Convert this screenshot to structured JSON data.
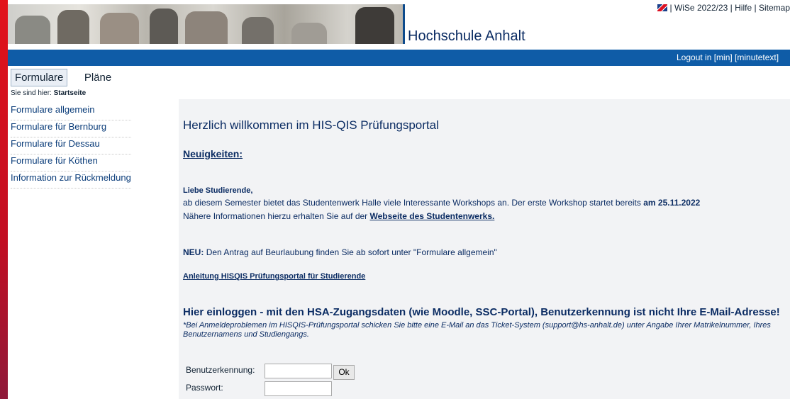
{
  "header": {
    "school_name": "Hochschule Anhalt",
    "semester": "WiSe 2022/23",
    "help": "Hilfe",
    "sitemap": "Sitemap",
    "separator": "|"
  },
  "bar": {
    "logout_text": "Logout in [min] [minutetext]"
  },
  "tabs": [
    {
      "label": "Formulare"
    },
    {
      "label": "Pläne"
    }
  ],
  "breadcrumb": {
    "prefix": "Sie sind hier:",
    "current": "Startseite"
  },
  "sidebar": {
    "items": [
      {
        "label": "Formulare allgemein"
      },
      {
        "label": "Formulare für Bernburg"
      },
      {
        "label": "Formulare für Dessau"
      },
      {
        "label": "Formulare für Köthen"
      },
      {
        "label": "Information zur Rückmeldung"
      }
    ]
  },
  "main": {
    "welcome": "Herzlich willkommen im HIS-QIS Prüfungsportal",
    "news_title": "Neuigkeiten:",
    "greeting": "Liebe Studierende,",
    "line1_text": "ab diesem Semester bietet das Studentenwerk Halle viele Interessante Workshops an. Der erste Workshop startet bereits",
    "line1_bold": "am 25.11.2022",
    "line2_text": "Nähere Informationen hierzu erhalten Sie auf der",
    "line2_link": "Webseite des Studentenwerks.",
    "neu_label": "NEU:",
    "neu_text": "Den Antrag auf Beurlaubung finden Sie ab sofort unter \"Formulare allgemein\"",
    "anleitung": "Anleitung HISQIS Prüfungsportal für Studierende",
    "login_heading": "Hier einloggen - mit den HSA-Zugangsdaten (wie Moodle, SSC-Portal), Benutzerkennung ist nicht Ihre E-Mail-Adresse!",
    "login_note": "*Bei Anmeldeproblemen im HISQIS-Prüfungsportal schicken Sie bitte eine E-Mail an das Ticket-System (support@hs-anhalt.de) unter Angabe Ihrer Matrikelnummer, Ihres Benutzernamens und Studiengangs."
  },
  "login": {
    "username_label": "Benutzerkennung:",
    "password_label": "Passwort:",
    "ok_label": "Ok",
    "username_value": "",
    "password_value": ""
  },
  "colors": {
    "accent_bar": "#0f5ca7",
    "text_dark": "#0b2c63",
    "left_stripe": "#e2131b",
    "content_bg": "#f2f3f5"
  }
}
